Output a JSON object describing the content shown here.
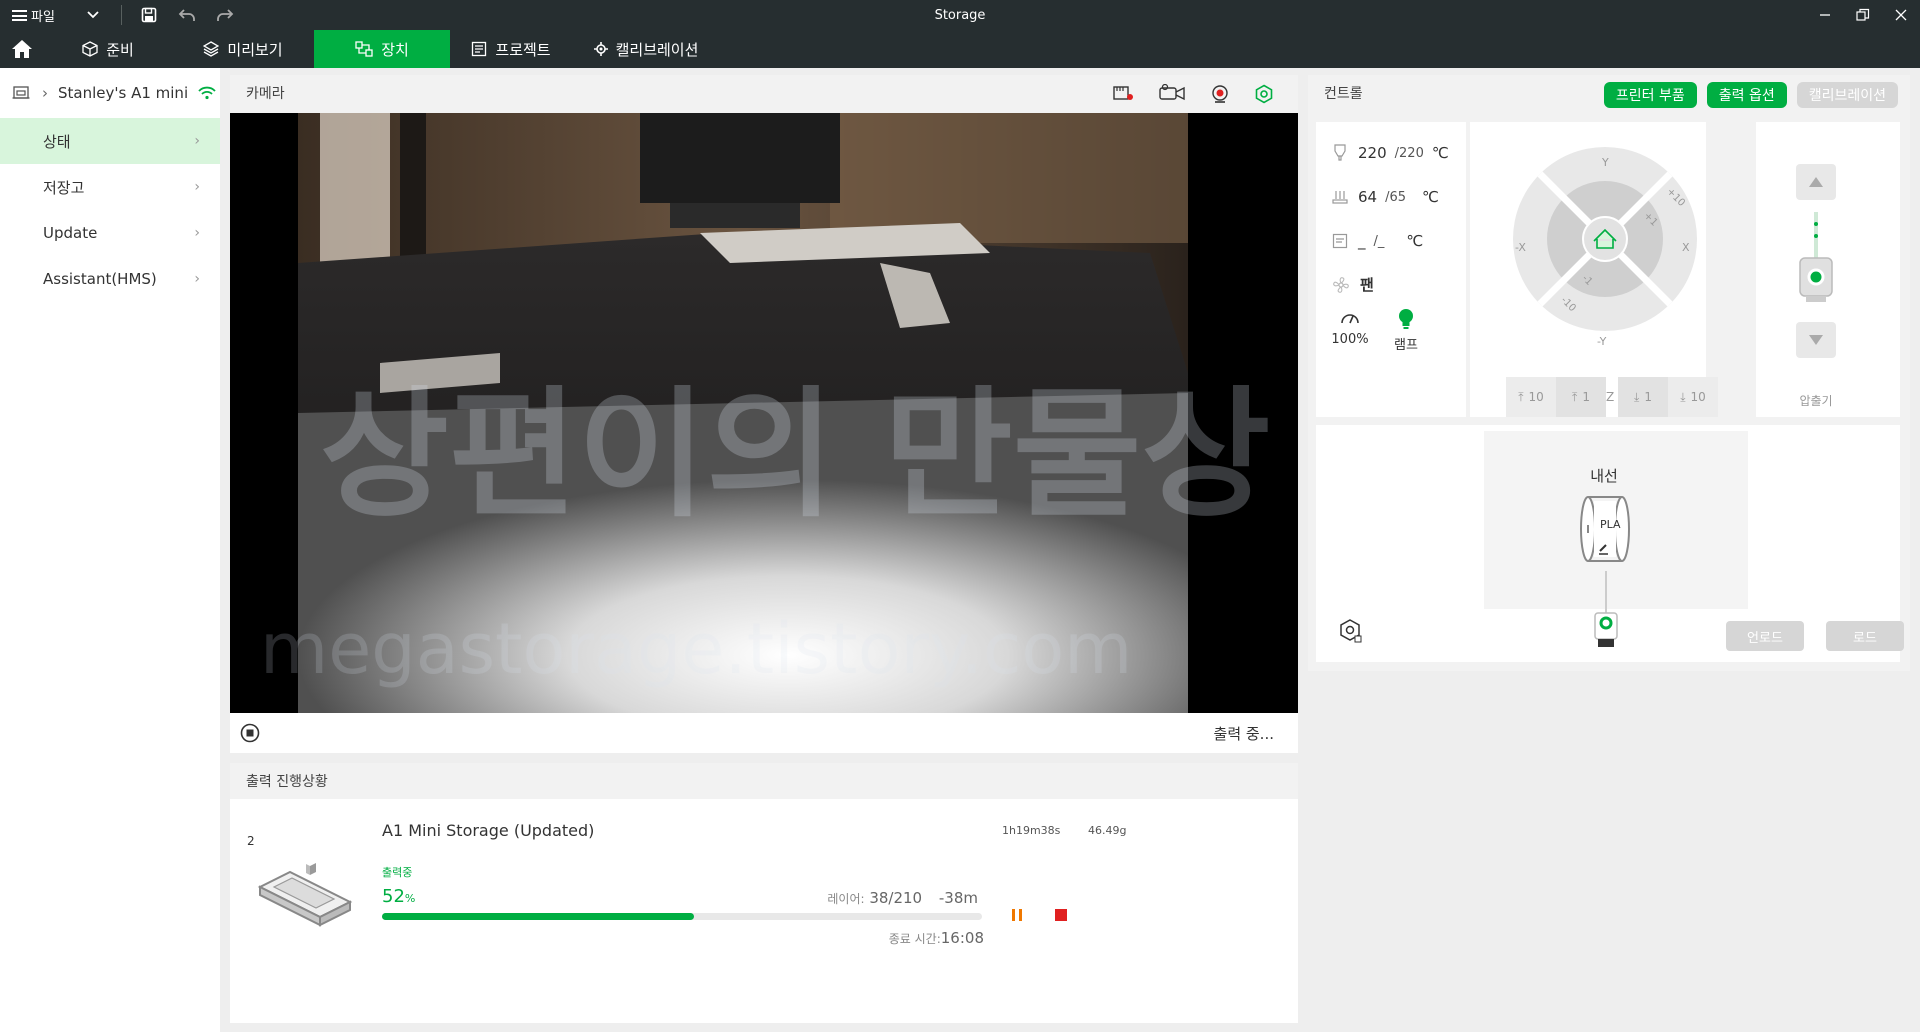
{
  "titlebar": {
    "menu_label": "파일",
    "title": "Storage"
  },
  "nav": {
    "tabs": [
      {
        "label": "준비",
        "icon": "cube-icon"
      },
      {
        "label": "미리보기",
        "icon": "layers-icon"
      },
      {
        "label": "장치",
        "icon": "device-icon",
        "active": true
      },
      {
        "label": "프로젝트",
        "icon": "project-icon"
      },
      {
        "label": "캘리브레이션",
        "icon": "calibration-icon"
      }
    ]
  },
  "sidebar": {
    "device_name": "Stanley's A1 mini",
    "items": [
      {
        "label": "상태",
        "active": true
      },
      {
        "label": "저장고"
      },
      {
        "label": "Update"
      },
      {
        "label": "Assistant(HMS)"
      }
    ]
  },
  "camera": {
    "header": "카메라",
    "status": "출력 중..."
  },
  "progress": {
    "header": "출력 진행상황",
    "plate_number": "2",
    "job_name": "A1 Mini Storage (Updated)",
    "time_total": "1h19m38s",
    "weight": "46.49g",
    "state": "출력중",
    "percent_value": "52",
    "percent_unit": "%",
    "percent_fraction": 0.52,
    "layer_label": "레이어:",
    "layer_value": "38/210",
    "remaining": "-38m",
    "end_label": "종료 시간:",
    "end_time": "16:08"
  },
  "control": {
    "header": "컨트롤",
    "buttons": {
      "parts": "프린터 부품",
      "options": "출력 옵션",
      "calibration": "캘리브레이션"
    },
    "nozzle": {
      "current": "220",
      "target": "/220",
      "unit": "℃"
    },
    "bed": {
      "current": "64",
      "target": "/65",
      "unit": "℃"
    },
    "chamber": {
      "current": "_",
      "target": "/_",
      "unit": "℃"
    },
    "fan_label": "팬",
    "speed_value": "100%",
    "lamp_label": "램프",
    "jog": {
      "y_plus": "Y",
      "y_minus": "-Y",
      "x_plus": "X",
      "x_minus": "-X",
      "step10_a": "+10",
      "step1_a": "+1",
      "step1_b": "-1",
      "step10_b": "-10",
      "z_buttons": [
        "10",
        "1",
        "Z",
        "1",
        "10"
      ]
    },
    "extruder_label": "압출기",
    "spool": {
      "title": "내선",
      "material": "PLA"
    },
    "unload_label": "언로드",
    "load_label": "로드"
  },
  "colors": {
    "accent": "#00ae42",
    "titlebar": "#262e30",
    "pause": "#f07800",
    "stop": "#e02020"
  }
}
